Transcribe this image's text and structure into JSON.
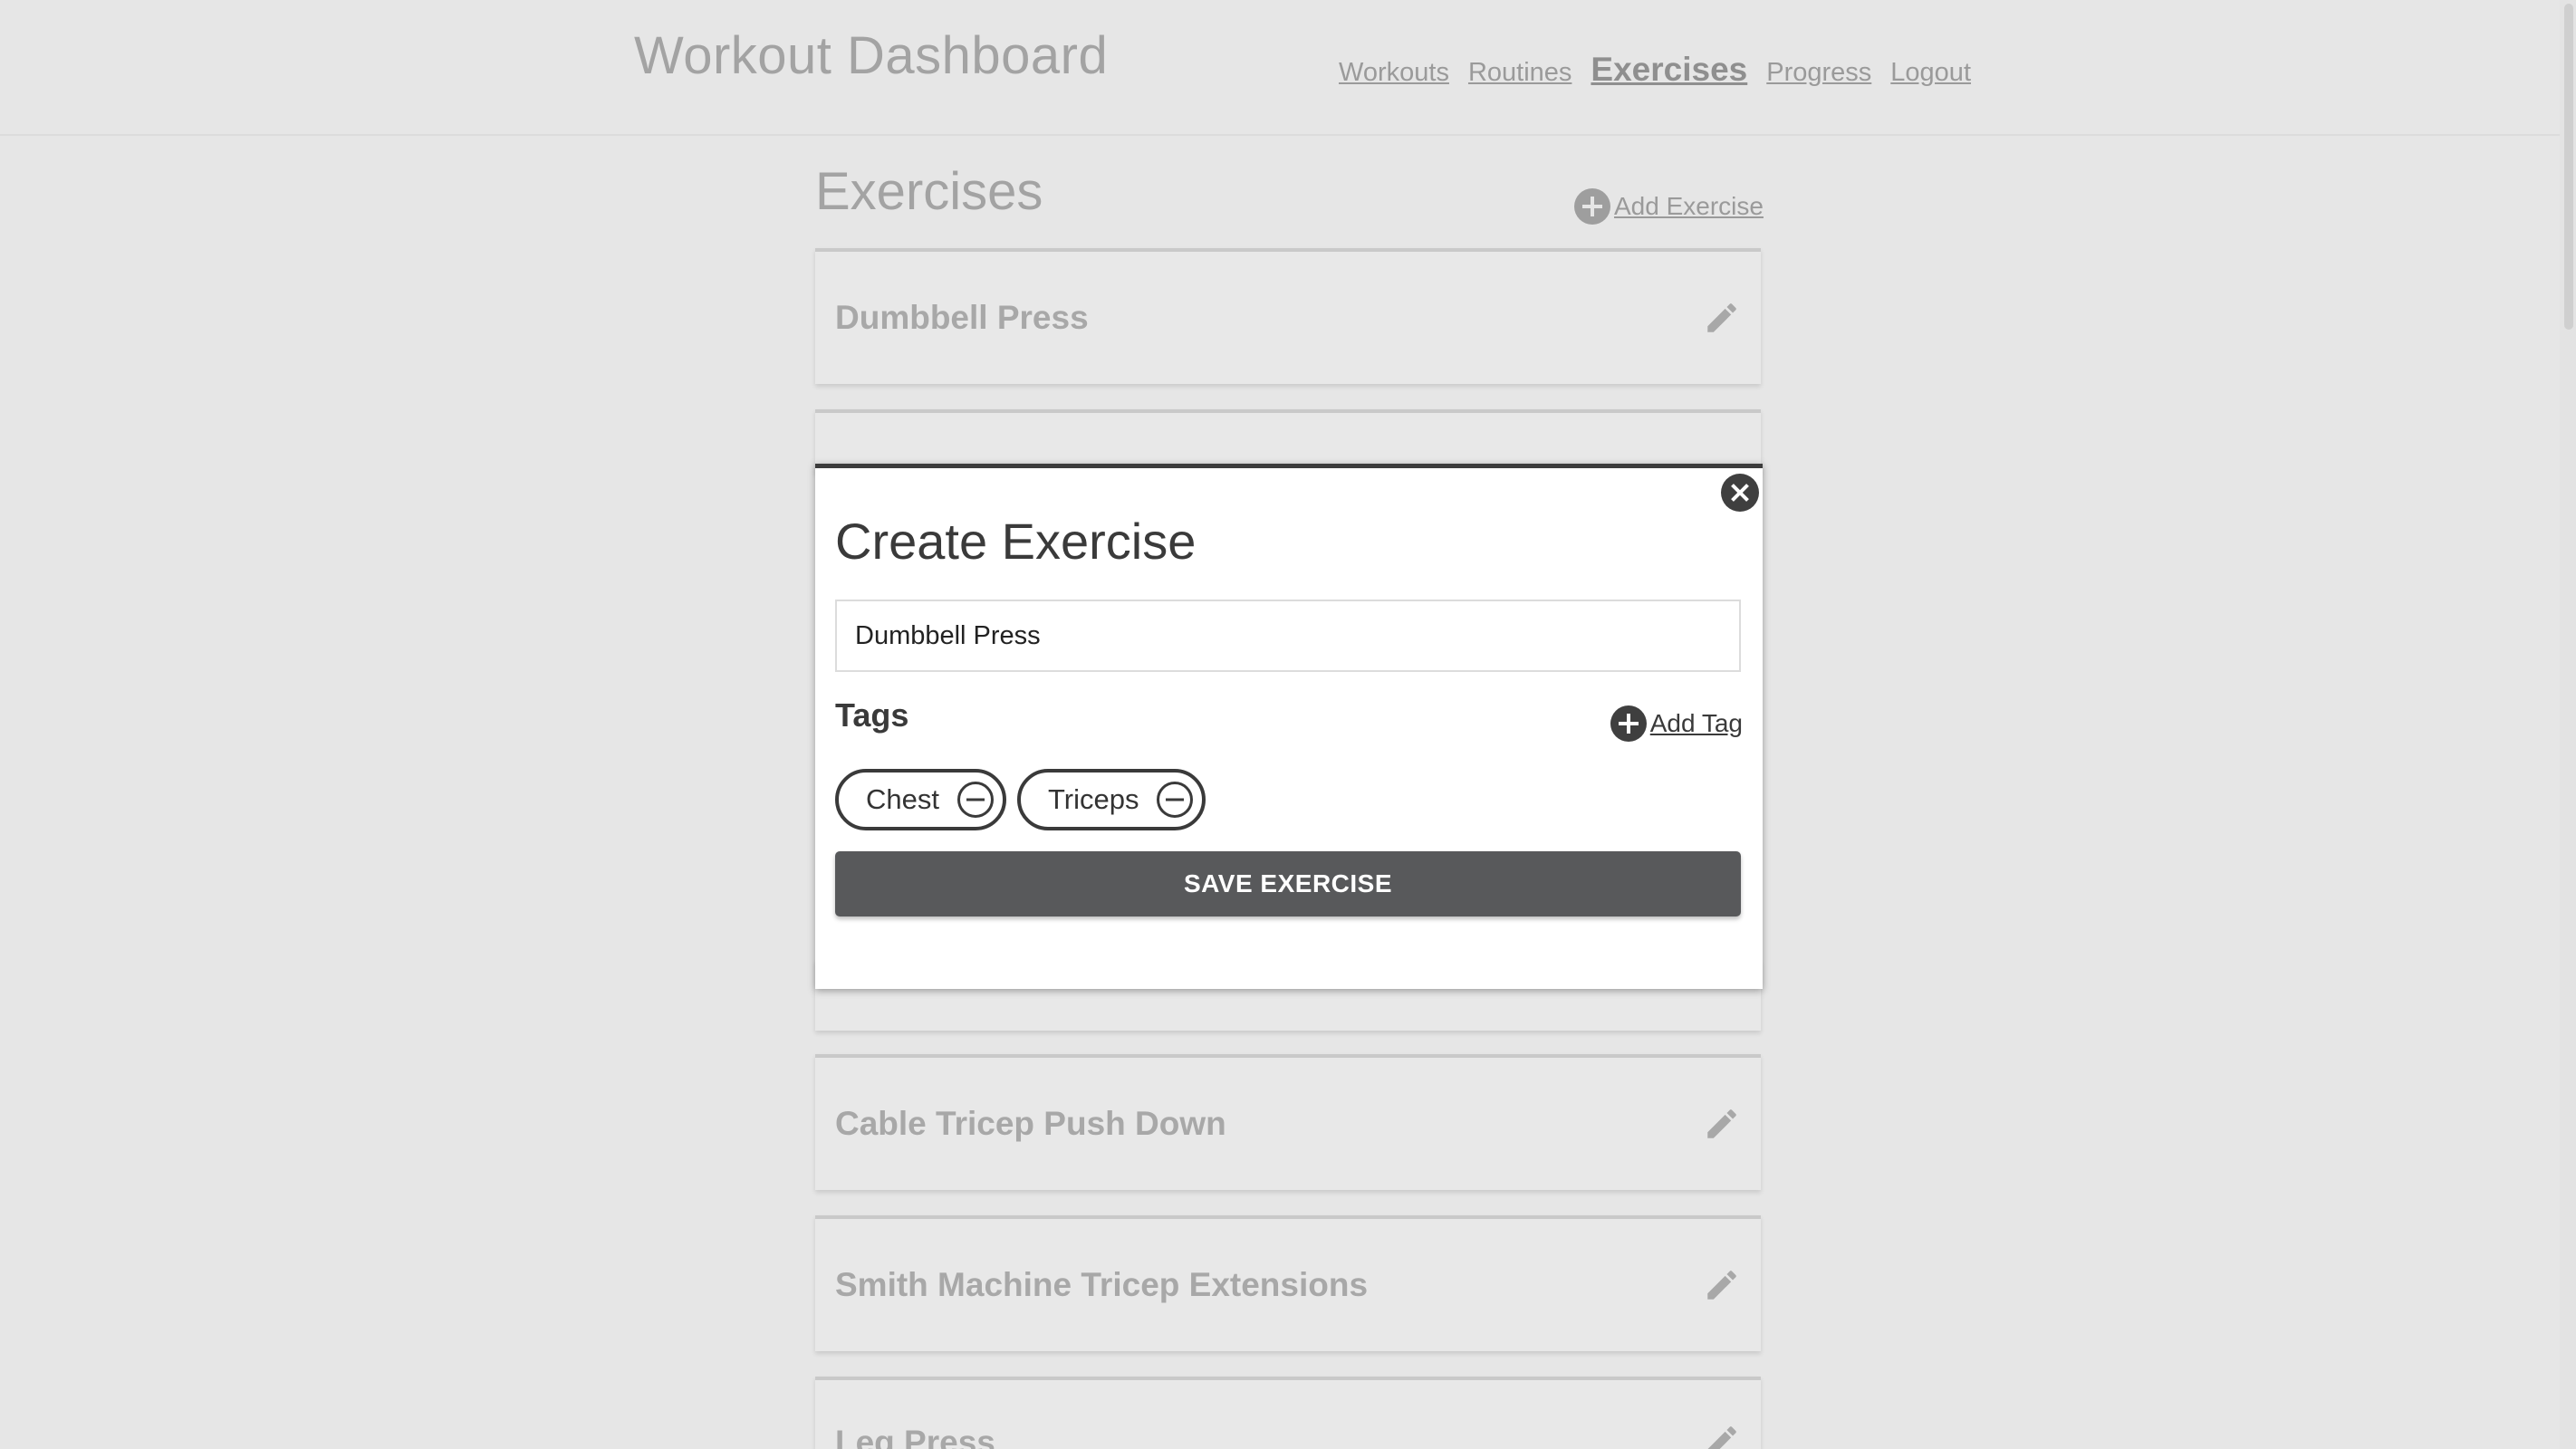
{
  "header": {
    "title": "Workout Dashboard",
    "nav": [
      "Workouts",
      "Routines",
      "Exercises",
      "Progress",
      "Logout"
    ],
    "active_nav": "Exercises"
  },
  "section": {
    "title": "Exercises",
    "add_label": "Add Exercise"
  },
  "exercises": [
    {
      "name": "Dumbbell Press"
    },
    {
      "name": ""
    },
    {
      "name": ""
    },
    {
      "name": "Cable Tricep Push Down"
    },
    {
      "name": "Smith Machine Tricep Extensions"
    },
    {
      "name": "Leg Press"
    }
  ],
  "modal": {
    "title": "Create Exercise",
    "name_value": "Dumbbell Press",
    "tags_label": "Tags",
    "add_tag_label": "Add Tag",
    "tags": [
      "Chest",
      "Triceps"
    ],
    "save_label": "SAVE EXERCISE"
  },
  "colors": {
    "background": "#e6e6e6",
    "modal_border": "#3c3c3c",
    "save_button": "#58595b",
    "muted_text": "#a3a3a3"
  },
  "icons": {
    "add": "plus-circle-icon",
    "edit": "pencil-icon",
    "close": "close-circle-icon",
    "remove_tag": "minus-circle-icon"
  }
}
